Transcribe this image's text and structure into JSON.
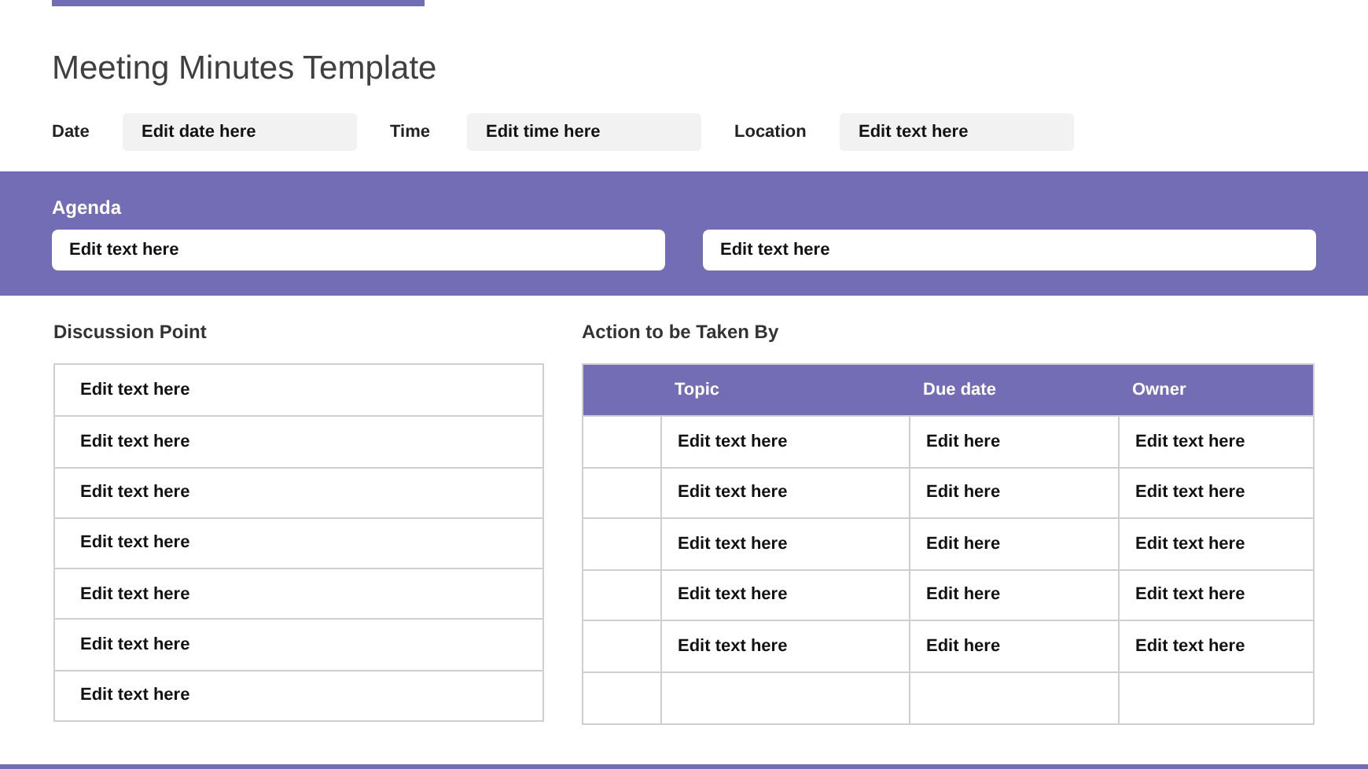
{
  "title": "Meeting Minutes Template",
  "fields": [
    {
      "label": "Date",
      "value": "Edit date here"
    },
    {
      "label": "Time",
      "value": "Edit time here"
    },
    {
      "label": "Location",
      "value": "Edit text here"
    }
  ],
  "agenda": {
    "heading": "Agenda",
    "items": [
      "Edit text here",
      "Edit text here"
    ]
  },
  "discussion": {
    "heading": "Discussion Point",
    "rows": [
      "Edit text here",
      "Edit text here",
      "Edit text here",
      "Edit text here",
      "Edit text here",
      "Edit text here",
      "Edit text here"
    ]
  },
  "actions": {
    "heading": "Action to be Taken By",
    "columns": [
      "Topic",
      "Due date",
      "Owner"
    ],
    "rows": [
      [
        "Edit text here",
        "Edit here",
        "Edit text here"
      ],
      [
        "Edit text here",
        "Edit here",
        "Edit text here"
      ],
      [
        "Edit text here",
        "Edit here",
        "Edit text here"
      ],
      [
        "Edit text here",
        "Edit here",
        "Edit text here"
      ],
      [
        "Edit text here",
        "Edit here",
        "Edit text here"
      ]
    ]
  }
}
